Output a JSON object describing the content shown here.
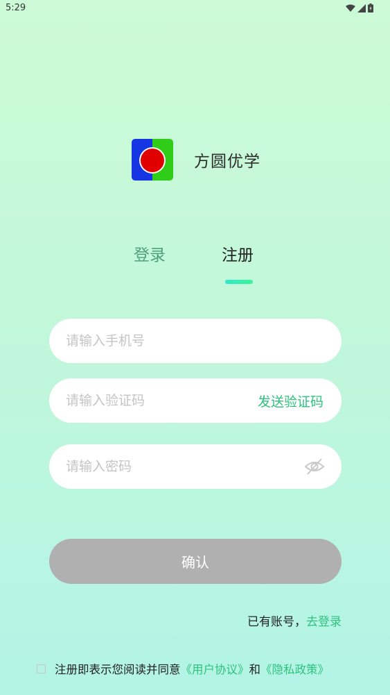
{
  "status_bar": {
    "time": "5:29",
    "icons": [
      "wifi-icon",
      "signal-icon",
      "battery-icon"
    ]
  },
  "brand": {
    "app_name": "方圆优学",
    "logo_icon": "app-logo-icon"
  },
  "tabs": [
    {
      "label": "登录",
      "active": false
    },
    {
      "label": "注册",
      "active": true
    }
  ],
  "form": {
    "phone_placeholder": "请输入手机号",
    "phone_value": "",
    "code_placeholder": "请输入验证码",
    "code_value": "",
    "send_code_label": "发送验证码",
    "password_placeholder": "请输入密码",
    "password_value": "",
    "password_toggle_icon": "eye-off-icon",
    "confirm_label": "确认"
  },
  "footer": {
    "have_account": "已有账号，",
    "go_login": "去登录"
  },
  "agreement": {
    "checked": false,
    "prefix": "注册即表示您阅读并同意",
    "user_agreement": "《用户协议》",
    "conjunction": "和",
    "privacy_policy": "《隐私政策》"
  },
  "colors": {
    "accent": "#2ec27e",
    "tab_inactive": "#4fa07e",
    "button_disabled": "#b0b0b0",
    "background_top": "#cdfbd7",
    "background_bottom": "#b3f4e6"
  }
}
